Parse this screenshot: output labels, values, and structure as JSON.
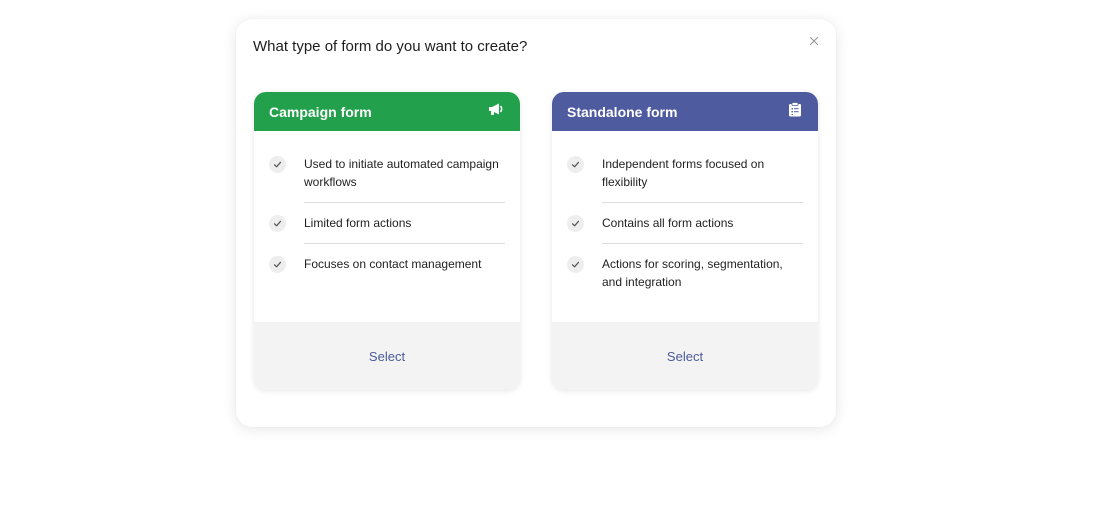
{
  "dialog": {
    "title": "What type of form do you want to create?",
    "close_icon": "close-icon"
  },
  "cards": [
    {
      "title": "Campaign form",
      "icon": "megaphone-icon",
      "header_color": "#22a04b",
      "features": [
        "Used to initiate automated campaign workflows",
        "Limited form actions",
        "Focuses on contact management"
      ],
      "select_label": "Select"
    },
    {
      "title": "Standalone form",
      "icon": "clipboard-icon",
      "header_color": "#4f5b9f",
      "features": [
        "Independent forms focused on flexibility",
        "Contains all form actions",
        "Actions for scoring, segmentation, and integration"
      ],
      "select_label": "Select"
    }
  ],
  "colors": {
    "accent_text": "#4a5a9a",
    "footer_bg": "#f3f3f3"
  }
}
